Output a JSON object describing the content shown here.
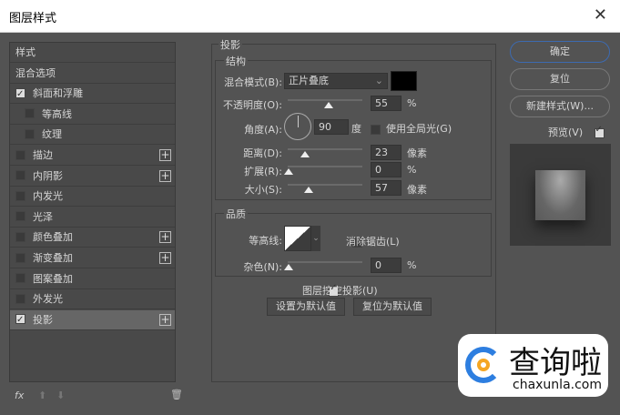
{
  "title": "图层样式",
  "left": {
    "items": [
      {
        "label": "样式",
        "cb": null,
        "plus": false
      },
      {
        "label": "混合选项",
        "cb": null,
        "plus": false
      },
      {
        "label": "斜面和浮雕",
        "cb": true,
        "plus": false
      },
      {
        "label": "等高线",
        "cb": false,
        "plus": false,
        "indent": true
      },
      {
        "label": "纹理",
        "cb": false,
        "plus": false,
        "indent": true
      },
      {
        "label": "描边",
        "cb": false,
        "plus": true
      },
      {
        "label": "内阴影",
        "cb": false,
        "plus": true
      },
      {
        "label": "内发光",
        "cb": false,
        "plus": false
      },
      {
        "label": "光泽",
        "cb": false,
        "plus": false
      },
      {
        "label": "颜色叠加",
        "cb": false,
        "plus": true
      },
      {
        "label": "渐变叠加",
        "cb": false,
        "plus": true
      },
      {
        "label": "图案叠加",
        "cb": false,
        "plus": false
      },
      {
        "label": "外发光",
        "cb": false,
        "plus": false
      },
      {
        "label": "投影",
        "cb": true,
        "plus": true,
        "selected": true
      }
    ],
    "fx": "fx"
  },
  "main": {
    "section": "投影",
    "structure": "结构",
    "blend_label": "混合模式(B):",
    "blend_value": "正片叠底",
    "shadow_color": "#000000",
    "opacity_label": "不透明度(O):",
    "opacity": "55",
    "pct": "%",
    "angle_label": "角度(A):",
    "angle": "90",
    "deg": "度",
    "global_light": "使用全局光(G)",
    "distance_label": "距离(D):",
    "distance": "23",
    "px": "像素",
    "spread_label": "扩展(R):",
    "spread": "0",
    "size_label": "大小(S):",
    "size": "57",
    "quality": "品质",
    "contour_label": "等高线:",
    "antialias": "消除锯齿(L)",
    "noise_label": "杂色(N):",
    "noise": "0",
    "knockout": "图层挖空投影(U)",
    "set_default": "设置为默认值",
    "reset_default": "复位为默认值"
  },
  "right": {
    "ok": "确定",
    "reset": "复位",
    "new_style": "新建样式(W)...",
    "preview": "预览(V)"
  },
  "watermark": {
    "cn": "查询啦",
    "en": "chaxunla.com"
  }
}
